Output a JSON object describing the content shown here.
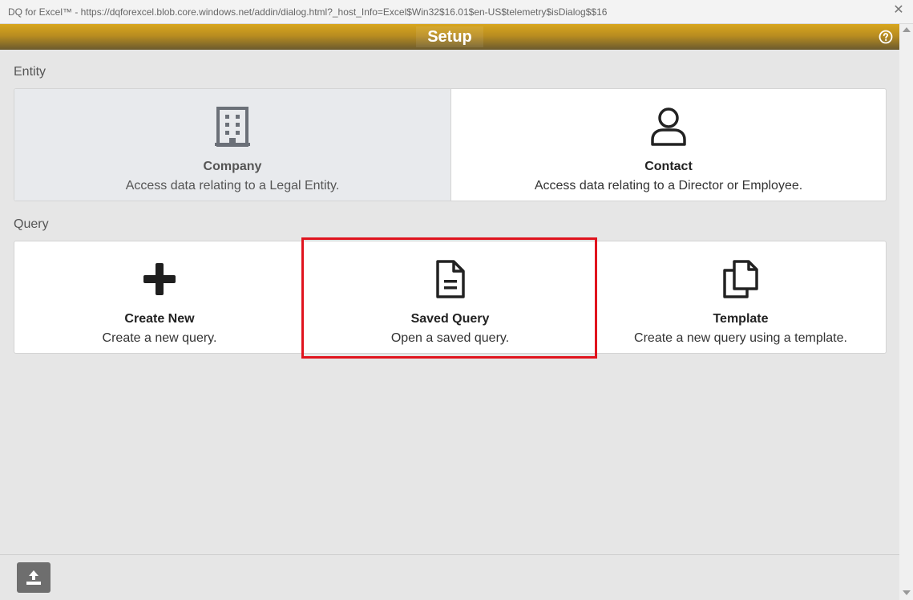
{
  "window": {
    "title": "DQ for Excel™ - https://dqforexcel.blob.core.windows.net/addin/dialog.html?_host_Info=Excel$Win32$16.01$en-US$telemetry$isDialog$$16",
    "close_glyph": "✕"
  },
  "header": {
    "title": "Setup",
    "help_icon": "help-circle-icon"
  },
  "entity": {
    "label": "Entity",
    "cards": [
      {
        "title": "Company",
        "description": "Access data relating to a Legal Entity.",
        "icon": "building-icon",
        "selected": true
      },
      {
        "title": "Contact",
        "description": "Access data relating to a Director or Employee.",
        "icon": "person-icon",
        "selected": false
      }
    ]
  },
  "query": {
    "label": "Query",
    "cards": [
      {
        "title": "Create New",
        "description": "Create a new query.",
        "icon": "plus-icon"
      },
      {
        "title": "Saved Query",
        "description": "Open a saved query.",
        "icon": "document-icon",
        "highlighted": true
      },
      {
        "title": "Template",
        "description": "Create a new query using a template.",
        "icon": "copy-icon"
      }
    ]
  },
  "footer": {
    "upload_icon": "upload-icon"
  },
  "colors": {
    "header_gold": "#d8a61d",
    "highlight_red": "#e0141e",
    "selected_card_bg": "#e8eaed"
  }
}
